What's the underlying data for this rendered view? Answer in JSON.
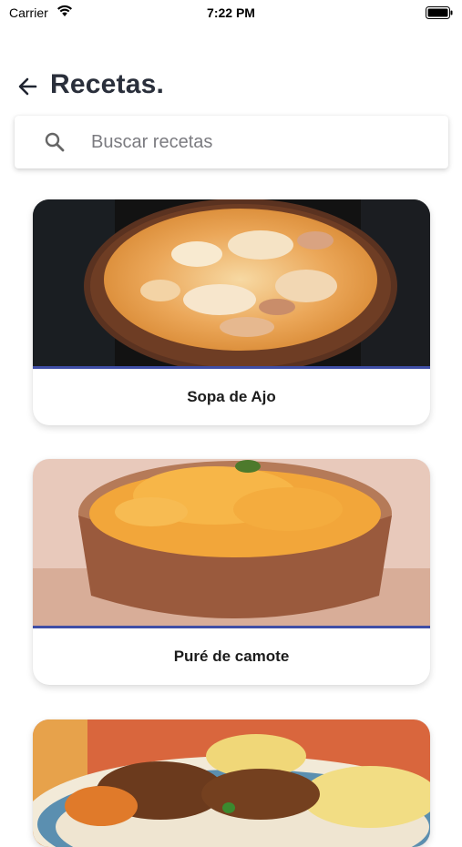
{
  "status_bar": {
    "carrier": "Carrier",
    "time": "7:22 PM"
  },
  "header": {
    "title": "Recetas."
  },
  "search": {
    "placeholder": "Buscar recetas",
    "value": ""
  },
  "recipes": [
    {
      "name": "Sopa de Ajo"
    },
    {
      "name": "Puré de camote"
    },
    {
      "name": ""
    }
  ],
  "colors": {
    "accent": "#3f4ea6",
    "title": "#2a2f3b"
  }
}
